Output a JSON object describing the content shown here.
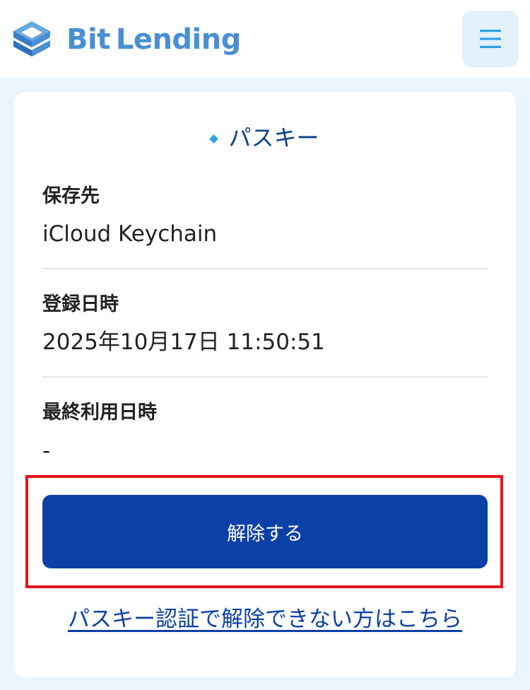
{
  "header": {
    "logo_text_part1": "Bit",
    "logo_text_part2": "Lending",
    "menu_icon": "hamburger-menu-icon",
    "colors": {
      "logo": "#4a8fd4",
      "menu_icon": "#2aa3e6"
    }
  },
  "passkey": {
    "section_title": "パスキー",
    "fields": [
      {
        "label": "保存先",
        "value": "iCloud Keychain"
      },
      {
        "label": "登録日時",
        "value": "2025年10月17日 11:50:51"
      },
      {
        "label": "最終利用日時",
        "value": "-"
      }
    ],
    "remove_button_label": "解除する",
    "alternate_link_text": "パスキー認証で解除できない方はこちら"
  },
  "colors": {
    "primary_button": "#0b40a6",
    "title": "#0e3f86",
    "accent": "#2aa3e6",
    "highlight_frame": "#e8141a",
    "page_background": "#eaf4fd"
  }
}
